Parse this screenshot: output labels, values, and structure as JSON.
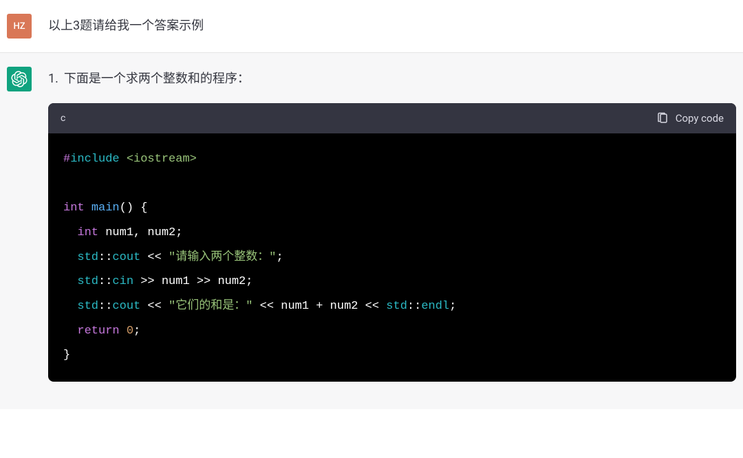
{
  "user": {
    "avatar_text": "HZ",
    "message": "以上3题请给我一个答案示例"
  },
  "assistant": {
    "list_number": "1.",
    "list_text": "下面是一个求两个整数和的程序：",
    "code_lang": "c",
    "copy_label": "Copy code",
    "code": {
      "l1_directive": "#",
      "l1_include": "include",
      "l1_header": "<iostream>",
      "l2_type": "int",
      "l2_func": "main",
      "l2_paren": "()",
      "l2_brace": " {",
      "l3_type": "int",
      "l3_vars": " num1, num2;",
      "l4_ns": "std",
      "l4_sep1": "::",
      "l4_cout": "cout",
      "l4_op1": " << ",
      "l4_str": "\"请输入两个整数：\"",
      "l4_semi": ";",
      "l5_ns": "std",
      "l5_sep1": "::",
      "l5_cin": "cin",
      "l5_op1": " >> num1 >> num2;",
      "l6_ns1": "std",
      "l6_sep1": "::",
      "l6_cout": "cout",
      "l6_op1": " << ",
      "l6_str": "\"它们的和是：\"",
      "l6_op2": " << num1 + num2 << ",
      "l6_ns2": "std",
      "l6_sep2": "::",
      "l6_endl": "endl",
      "l6_semi": ";",
      "l7_return": "return",
      "l7_zero": "0",
      "l7_semi": ";",
      "l8_brace": "}"
    }
  }
}
